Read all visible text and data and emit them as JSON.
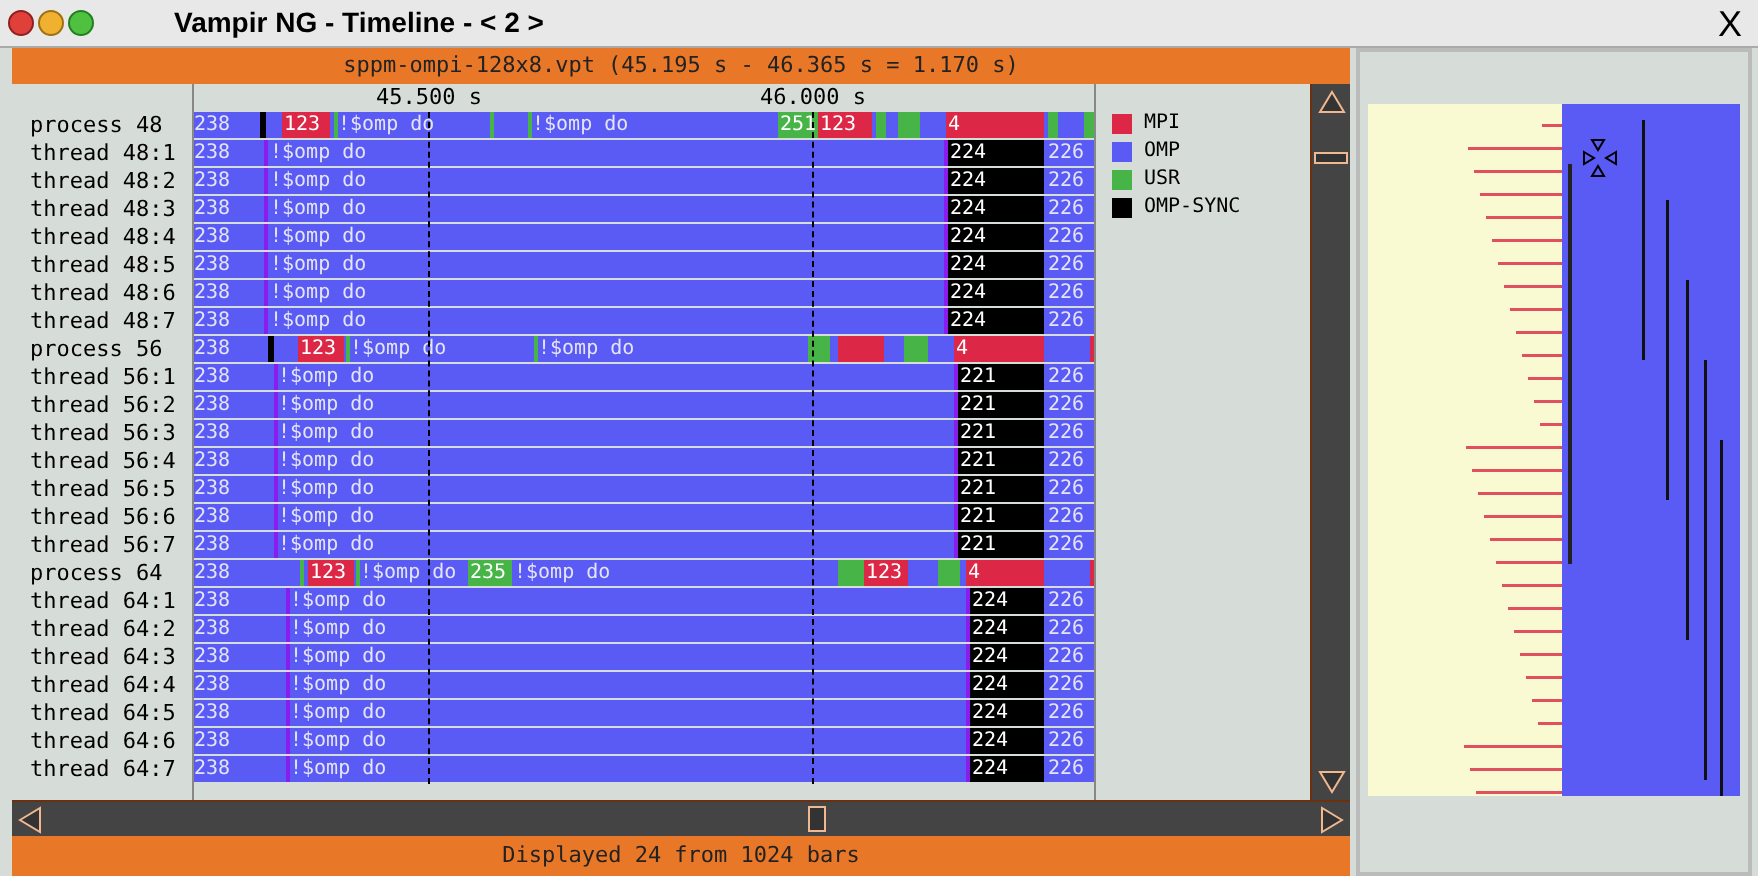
{
  "window": {
    "title": "Vampir NG - Timeline - < 2 >",
    "close": "X"
  },
  "header": "sppm-ompi-128x8.vpt (45.195 s - 46.365 s = 1.170 s)",
  "axis": [
    "45.500 s",
    "46.000 s"
  ],
  "rows": [
    {
      "name": "process 48",
      "kind": "process",
      "labels": [
        "238",
        "123",
        "!$omp do",
        "!$omp do",
        "251",
        "123",
        "4"
      ]
    },
    {
      "name": "thread 48:1",
      "kind": "thread",
      "labels": [
        "238",
        "!$omp do",
        "224",
        "226"
      ]
    },
    {
      "name": "thread 48:2",
      "kind": "thread",
      "labels": [
        "238",
        "!$omp do",
        "224",
        "226"
      ]
    },
    {
      "name": "thread 48:3",
      "kind": "thread",
      "labels": [
        "238",
        "!$omp do",
        "224",
        "226"
      ]
    },
    {
      "name": "thread 48:4",
      "kind": "thread",
      "labels": [
        "238",
        "!$omp do",
        "224",
        "226"
      ]
    },
    {
      "name": "thread 48:5",
      "kind": "thread",
      "labels": [
        "238",
        "!$omp do",
        "224",
        "226"
      ]
    },
    {
      "name": "thread 48:6",
      "kind": "thread",
      "labels": [
        "238",
        "!$omp do",
        "224",
        "226"
      ]
    },
    {
      "name": "thread 48:7",
      "kind": "thread",
      "labels": [
        "238",
        "!$omp do",
        "224",
        "226"
      ]
    },
    {
      "name": "process 56",
      "kind": "process",
      "labels": [
        "238",
        "123",
        "!$omp do",
        "!$omp do",
        "4"
      ]
    },
    {
      "name": "thread 56:1",
      "kind": "thread",
      "labels": [
        "238",
        "!$omp do",
        "221",
        "226"
      ]
    },
    {
      "name": "thread 56:2",
      "kind": "thread",
      "labels": [
        "238",
        "!$omp do",
        "221",
        "226"
      ]
    },
    {
      "name": "thread 56:3",
      "kind": "thread",
      "labels": [
        "238",
        "!$omp do",
        "221",
        "226"
      ]
    },
    {
      "name": "thread 56:4",
      "kind": "thread",
      "labels": [
        "238",
        "!$omp do",
        "221",
        "226"
      ]
    },
    {
      "name": "thread 56:5",
      "kind": "thread",
      "labels": [
        "238",
        "!$omp do",
        "221",
        "226"
      ]
    },
    {
      "name": "thread 56:6",
      "kind": "thread",
      "labels": [
        "238",
        "!$omp do",
        "221",
        "226"
      ]
    },
    {
      "name": "thread 56:7",
      "kind": "thread",
      "labels": [
        "238",
        "!$omp do",
        "221",
        "226"
      ]
    },
    {
      "name": "process 64",
      "kind": "process",
      "labels": [
        "238",
        "123",
        "!$omp do",
        "235",
        "!$omp do",
        "123",
        "4"
      ]
    },
    {
      "name": "thread 64:1",
      "kind": "thread",
      "labels": [
        "238",
        "!$omp do",
        "224",
        "226"
      ]
    },
    {
      "name": "thread 64:2",
      "kind": "thread",
      "labels": [
        "238",
        "!$omp do",
        "224",
        "226"
      ]
    },
    {
      "name": "thread 64:3",
      "kind": "thread",
      "labels": [
        "238",
        "!$omp do",
        "224",
        "226"
      ]
    },
    {
      "name": "thread 64:4",
      "kind": "thread",
      "labels": [
        "238",
        "!$omp do",
        "224",
        "226"
      ]
    },
    {
      "name": "thread 64:5",
      "kind": "thread",
      "labels": [
        "238",
        "!$omp do",
        "224",
        "226"
      ]
    },
    {
      "name": "thread 64:6",
      "kind": "thread",
      "labels": [
        "238",
        "!$omp do",
        "224",
        "226"
      ]
    },
    {
      "name": "thread 64:7",
      "kind": "thread",
      "labels": [
        "238",
        "!$omp do",
        "224",
        "226"
      ]
    }
  ],
  "legend": [
    {
      "label": "MPI",
      "color": "#dc2846"
    },
    {
      "label": "OMP",
      "color": "#5a5af5"
    },
    {
      "label": "USR",
      "color": "#46b446"
    },
    {
      "label": "OMP-SYNC",
      "color": "#000000"
    }
  ],
  "status": "Displayed 24 from 1024 bars"
}
